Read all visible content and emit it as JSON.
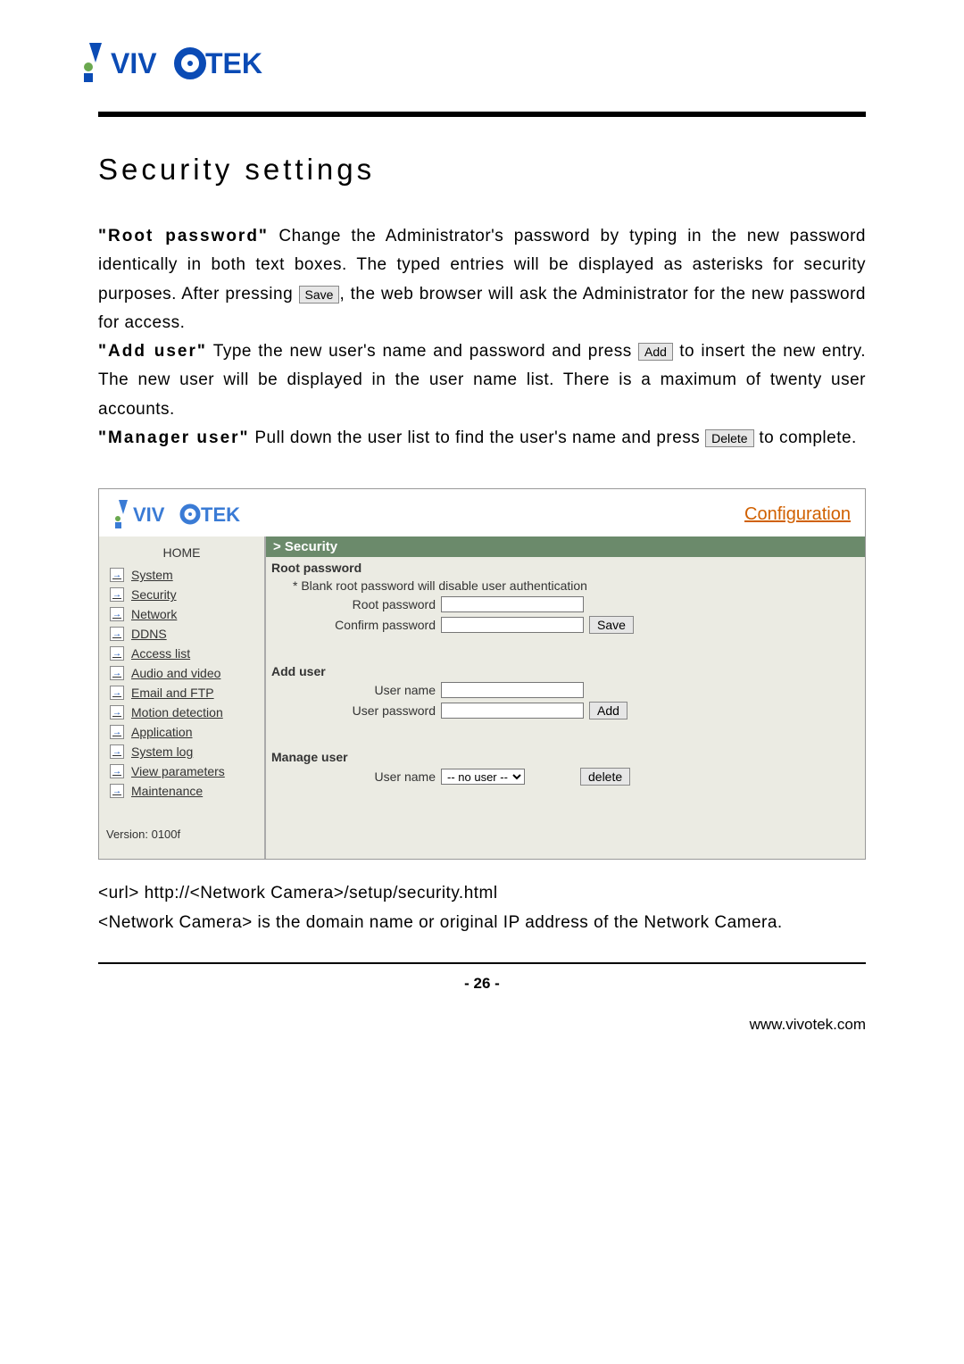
{
  "brand": "VIVOTEK",
  "title": "Security settings",
  "para1": {
    "label": "\"Root password\"",
    "before": "Change the Administrator's password by typing in the new password identically in both text boxes. The typed entries will be displayed as asterisks for security purposes. After pressing ",
    "button": "Save",
    "after": ", the web browser will ask the Administrator for the new password for access."
  },
  "para2": {
    "label": "\"Add user\"",
    "before": "Type the new user's name and password and press ",
    "button": "Add",
    "after": " to insert the new entry. The new user will be displayed in the user name list. There is a maximum of twenty user accounts."
  },
  "para3": {
    "label": "\"Manager user\"",
    "before": "Pull down the user list to find the user's name and press ",
    "button": "Delete",
    "after": " to complete."
  },
  "config": {
    "link": "Configuration",
    "breadcrumb": "> Security",
    "sidebar": {
      "home": "HOME",
      "items": [
        "System",
        "Security",
        "Network",
        "DDNS",
        "Access list",
        "Audio and video",
        "Email and FTP",
        "Motion detection",
        "Application",
        "System log",
        "View parameters",
        "Maintenance"
      ],
      "version": "Version: 0100f"
    },
    "root": {
      "title": "Root password",
      "note": "* Blank root password will disable user authentication",
      "field1": "Root password",
      "field2": "Confirm password",
      "button": "Save"
    },
    "adduser": {
      "title": "Add user",
      "field1": "User name",
      "field2": "User password",
      "button": "Add"
    },
    "manage": {
      "title": "Manage user",
      "field": "User name",
      "option": "-- no user --",
      "button": "delete"
    }
  },
  "url_line": "<url> http://<Network Camera>/setup/security.html",
  "note_line": "<Network Camera> is the domain name or original IP address of the Network Camera.",
  "page_number": "- 26 -",
  "website": "www.vivotek.com"
}
